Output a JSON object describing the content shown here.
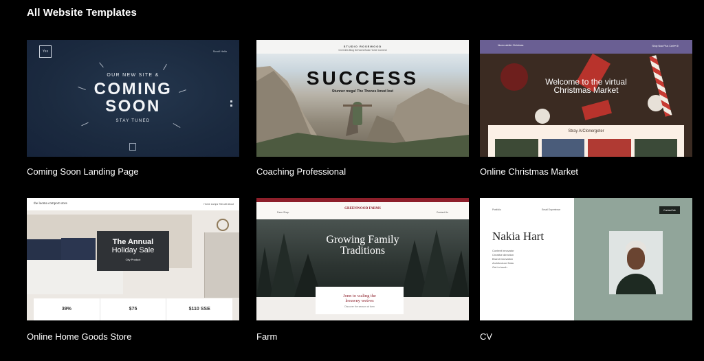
{
  "page_title": "All Website Templates",
  "templates": [
    {
      "label": "Coming Soon Landing Page",
      "thumb": {
        "logo": "Yes",
        "nav": "Scroll  Hello",
        "pre": "OUR NEW SITE &",
        "line1": "COMING",
        "line2": "SOON",
        "sub": "STAY TUNED"
      }
    },
    {
      "label": "Coaching Professional",
      "thumb": {
        "nav_title": "STUDIO ROSEWOOD",
        "nav_links": "Overview   Blog   Services   Book   Home   Connect",
        "big": "SUCCESS",
        "sub": "Stunner mega! The Thones limed lost"
      }
    },
    {
      "label": "Online Christmas Market",
      "thumb": {
        "logo": "Nuovo atelier Christmas",
        "nav": "Shop Now   Plus Cart   ♥   ⚙",
        "head_line1": "Welcome to the virtual",
        "head_line2": "Christmas Market",
        "panel_title": "Stray A/Clonergeter"
      }
    },
    {
      "label": "Online Home Goods Store",
      "thumb": {
        "brand": "the looma comport store",
        "nav": "Home   Lamps   Tiles   All   About",
        "sale1": "The Annual",
        "sale2": "Holiday Sale",
        "sale3": "City Product",
        "strip": [
          "39%",
          "$75",
          "$110 SSE"
        ]
      }
    },
    {
      "label": "Farm",
      "thumb": {
        "brand": "GREENWOOD FARMS",
        "left": "Farm Shop",
        "right": "Contact Us",
        "head_line1": "Growing Family",
        "head_line2": "Traditions",
        "card_line1": "Jonn to waling the",
        "card_line2": "lrouwny wetves",
        "card_sub": "Discover the season at farm"
      }
    },
    {
      "label": "CV",
      "thumb": {
        "top_left": "Portfolio",
        "top_mid": "Email   Experience",
        "button": "Contact Me",
        "name": "Nakia Hart",
        "lines": [
          "Content innovator",
          "",
          "Creative direction",
          "Brand innovation",
          "Architecture Data",
          "",
          "Get in touch"
        ]
      }
    }
  ]
}
